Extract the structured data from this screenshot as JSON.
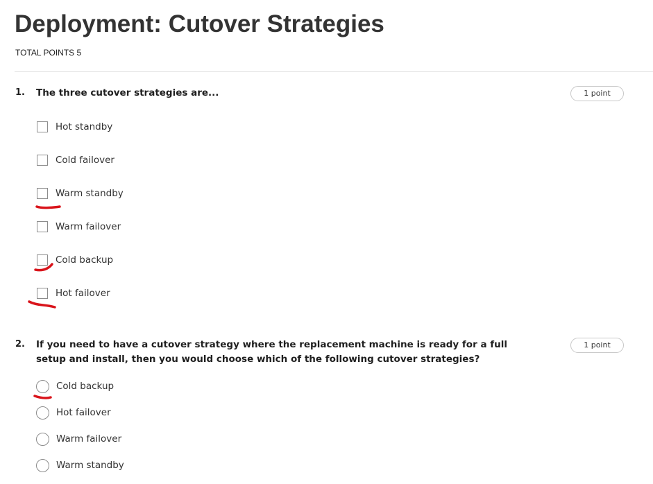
{
  "page": {
    "title": "Deployment: Cutover Strategies",
    "total_points": "TOTAL POINTS 5"
  },
  "questions": [
    {
      "number": "1.",
      "text": "The three cutover strategies are...",
      "points": "1 point",
      "input_type": "checkbox",
      "options": [
        {
          "label": "Hot standby",
          "checked": false,
          "marked": false
        },
        {
          "label": "Cold failover",
          "checked": false,
          "marked": false
        },
        {
          "label": "Warm standby",
          "checked": false,
          "marked": true
        },
        {
          "label": "Warm failover",
          "checked": false,
          "marked": false
        },
        {
          "label": "Cold backup",
          "checked": false,
          "marked": true
        },
        {
          "label": "Hot failover",
          "checked": false,
          "marked": true
        }
      ]
    },
    {
      "number": "2.",
      "text": "If you need to have a cutover strategy where the replacement machine is ready for a full setup and install, then you would choose which of the following cutover strategies?",
      "points": "1 point",
      "input_type": "radio",
      "options": [
        {
          "label": "Cold backup",
          "checked": false,
          "marked": true
        },
        {
          "label": "Hot failover",
          "checked": false,
          "marked": false
        },
        {
          "label": "Warm failover",
          "checked": false,
          "marked": false
        },
        {
          "label": "Warm standby",
          "checked": false,
          "marked": false
        }
      ]
    }
  ],
  "colors": {
    "annotation": "#d9141b",
    "title": "#333333",
    "divider": "#e1e1e1",
    "control_border": "#8c8c8c"
  }
}
